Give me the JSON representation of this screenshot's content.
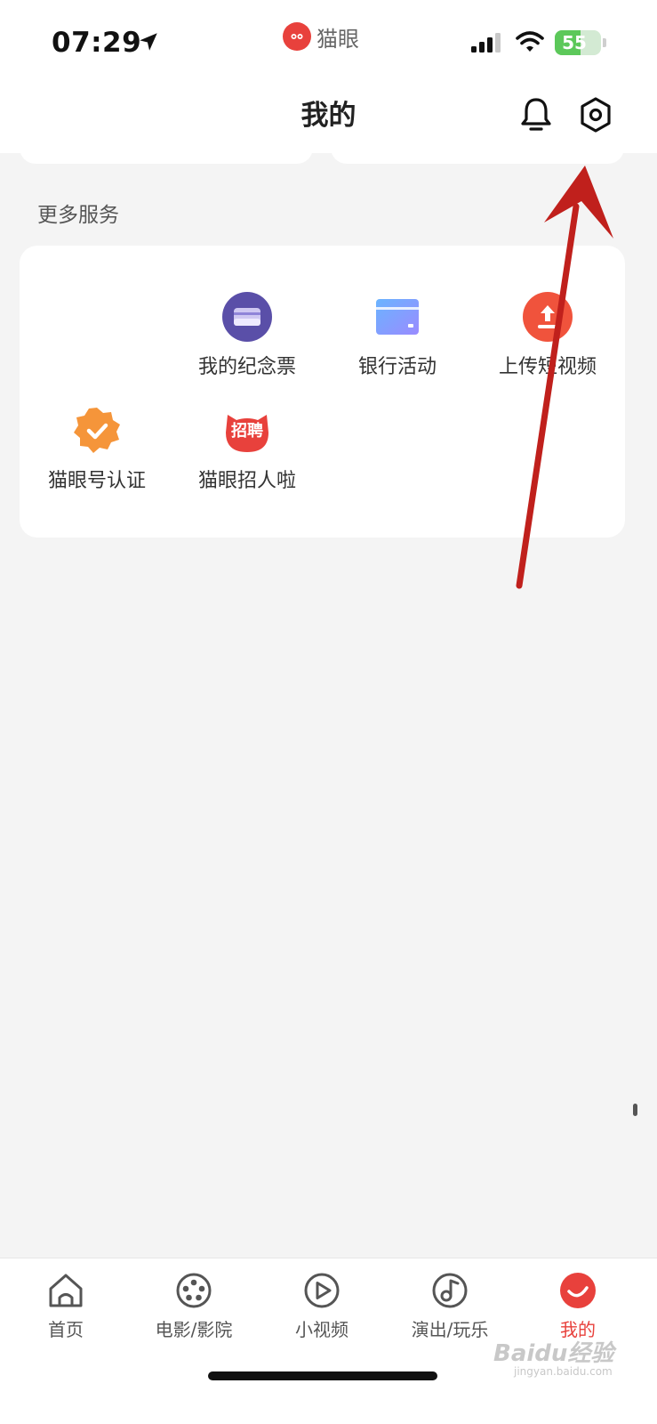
{
  "status_bar": {
    "time": "07:29",
    "battery": "55",
    "battery_percent": 55,
    "icons": [
      "location-arrow-icon",
      "signal-icon",
      "wifi-icon",
      "battery-icon"
    ]
  },
  "brand": {
    "name": "猫眼",
    "logo": "maoyan-cat-logo"
  },
  "header": {
    "title": "我的",
    "icons": [
      "bell-icon",
      "settings-hexagon-icon"
    ]
  },
  "more_services": {
    "title": "更多服务",
    "items": [
      {
        "label": "我的纪念票",
        "icon": "souvenir-ticket-icon"
      },
      {
        "label": "银行活动",
        "icon": "bank-card-icon"
      },
      {
        "label": "上传短视频",
        "icon": "upload-video-icon"
      },
      {
        "label": "猫眼号认证",
        "icon": "verified-badge-icon"
      },
      {
        "label": "猫眼招人啦",
        "icon": "recruiting-icon",
        "icon_text": "招聘"
      }
    ]
  },
  "tab_bar": {
    "tabs": [
      {
        "label": "首页",
        "icon": "home-icon",
        "active": false
      },
      {
        "label": "电影/影院",
        "icon": "film-reel-icon",
        "active": false
      },
      {
        "label": "小视频",
        "icon": "play-circle-icon",
        "active": false
      },
      {
        "label": "演出/玩乐",
        "icon": "music-note-icon",
        "active": false
      },
      {
        "label": "我的",
        "icon": "profile-icon",
        "active": true
      }
    ]
  },
  "watermark": {
    "text": "Baidu经验",
    "sub": "jingyan.baidu.com"
  },
  "colors": {
    "accent": "#e8413c",
    "annotation_arrow": "#c0201c",
    "background": "#f4f4f4",
    "card": "#ffffff"
  }
}
